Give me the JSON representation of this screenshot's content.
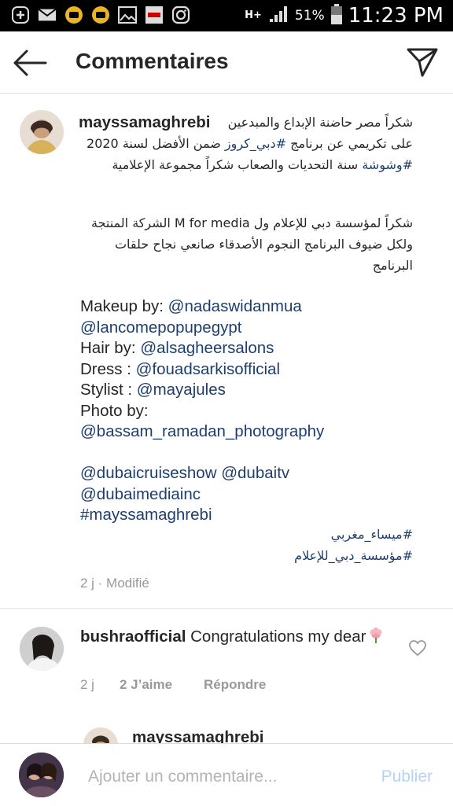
{
  "status_bar": {
    "battery_percent": "51%",
    "time": "11:23 PM",
    "network": "H+",
    "icons": [
      "add-icon",
      "mail-icon",
      "app-icon",
      "app-icon",
      "image-icon",
      "news-icon",
      "instagram-icon"
    ]
  },
  "header": {
    "title": "Commentaires",
    "back_icon": "arrow-left-icon",
    "send_icon": "send-icon"
  },
  "post": {
    "username": "mayssamaghrebi",
    "arabic_para1_pre": "شكراً مصر حاضنة الإبداع والمبدعين على تكريمي عن برنامج ",
    "arabic_tag1": "#دبي_كروز",
    "arabic_para1_mid": " ضمن الأفضل لسنة 2020 ",
    "arabic_tag2": "#وشوشة",
    "arabic_para1_post": " سنة التحديات والصعاب شكراً مجموعة الإعلامية",
    "arabic_para2": "شكراً لمؤسسة دبي للإعلام ول M for media الشركة المنتجة ولكل ضيوف البرنامج النجوم الأصدقاء صانعي نجاح حلقات البرنامج",
    "makeup_label": "Makeup by: ",
    "makeup_tag": "@nadaswidanmua",
    "makeup_tag2": "@lancomepopupegypt",
    "hair_label": "Hair by: ",
    "hair_tag": "@alsagheersalons",
    "dress_label": "Dress : ",
    "dress_tag": "@fouadsarkisofficial",
    "stylist_label": "Stylist : ",
    "stylist_tag": "@mayajules",
    "photo_label": "Photo by:",
    "photo_tag": "@bassam_ramadan_photography",
    "tag_dubaicruiseshow": "@dubaicruiseshow",
    "tag_dubaitv": "@dubaitv",
    "tag_dubaimediainc": "@dubaimediainc",
    "tag_hashtag": "#mayssamaghrebi",
    "arabic_hashtag1": "#ميساء_مغربي",
    "arabic_hashtag2": "#مؤسسة_دبي_للإعلام",
    "meta": "2 j · Modifié"
  },
  "comment": {
    "username": "bushraofficial",
    "text": "Congratulations my dear",
    "emoji_icon": "flower-icon",
    "time": "2 j",
    "likes": "2 J’aime",
    "reply": "Répondre",
    "like_icon": "heart-icon"
  },
  "reply_preview": {
    "username": "mayssamaghrebi"
  },
  "composer": {
    "placeholder": "Ajouter un commentaire...",
    "publish": "Publier"
  }
}
